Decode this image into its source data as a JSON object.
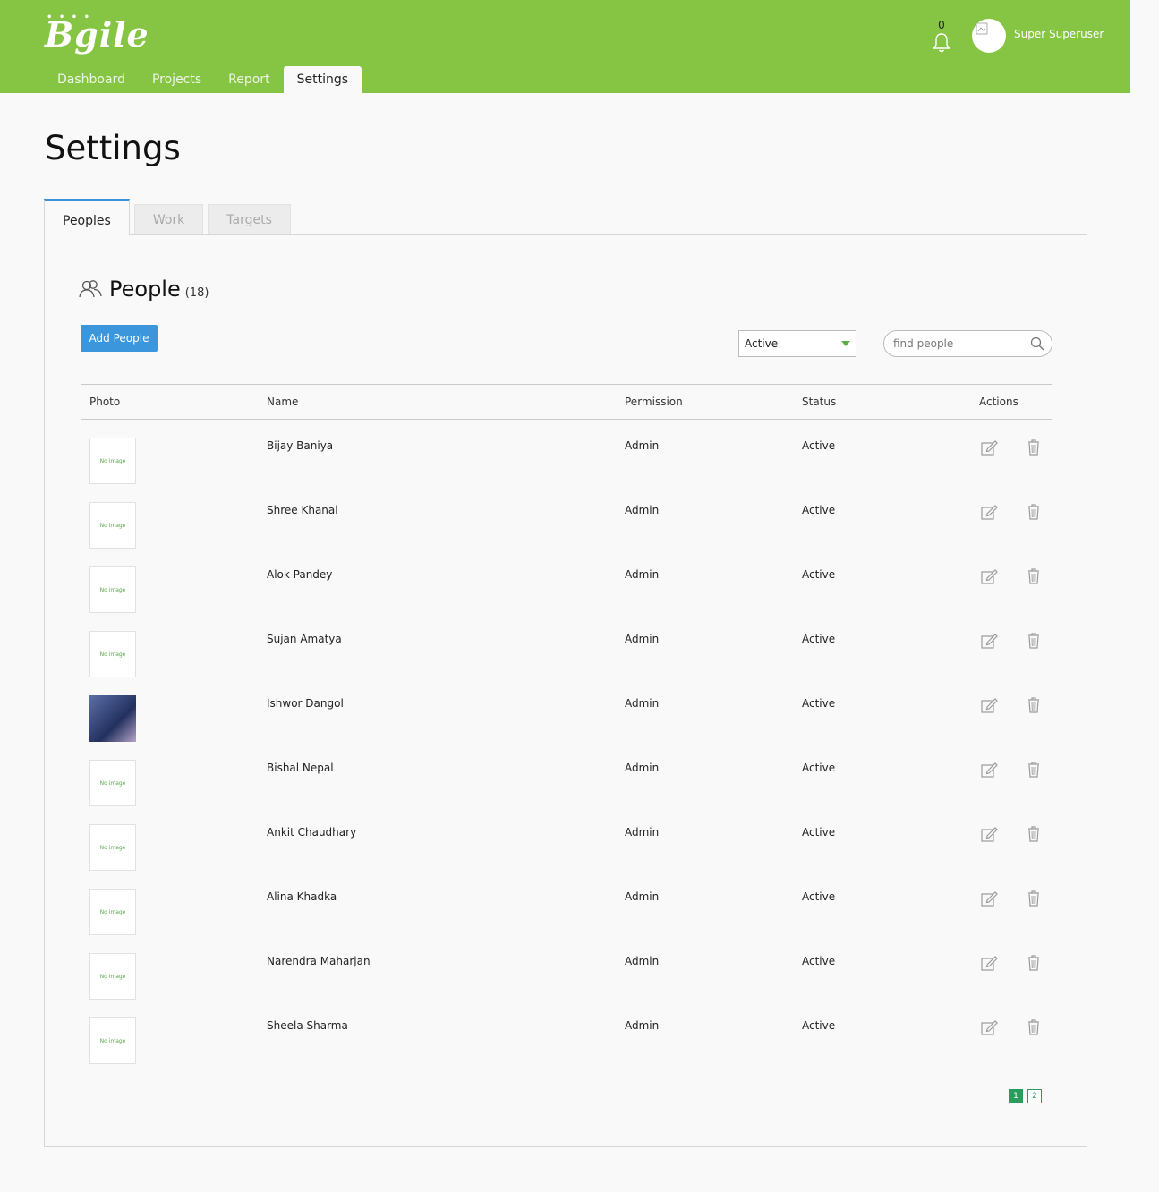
{
  "app": {
    "logo_text": "Bgile"
  },
  "nav": {
    "tabs": [
      "Dashboard",
      "Projects",
      "Report",
      "Settings"
    ],
    "active": "Settings"
  },
  "header": {
    "notification_count": "0",
    "user_name": "Super Superuser"
  },
  "page": {
    "title": "Settings"
  },
  "settings_tabs": [
    "Peoples",
    "Work",
    "Targets"
  ],
  "people": {
    "title": "People",
    "count": "(18)",
    "add_button": "Add People",
    "status_filter": "Active",
    "search_placeholder": "find people",
    "columns": [
      "Photo",
      "Name",
      "Permission",
      "Status",
      "Actions"
    ],
    "no_image_text": "No image",
    "rows": [
      {
        "name": "Bijay Baniya",
        "permission": "Admin",
        "status": "Active",
        "has_photo": false
      },
      {
        "name": "Shree Khanal",
        "permission": "Admin",
        "status": "Active",
        "has_photo": false
      },
      {
        "name": "Alok Pandey",
        "permission": "Admin",
        "status": "Active",
        "has_photo": false
      },
      {
        "name": "Sujan Amatya",
        "permission": "Admin",
        "status": "Active",
        "has_photo": false
      },
      {
        "name": "Ishwor Dangol",
        "permission": "Admin",
        "status": "Active",
        "has_photo": true
      },
      {
        "name": "Bishal Nepal",
        "permission": "Admin",
        "status": "Active",
        "has_photo": false
      },
      {
        "name": "Ankit Chaudhary",
        "permission": "Admin",
        "status": "Active",
        "has_photo": false
      },
      {
        "name": "Alina Khadka",
        "permission": "Admin",
        "status": "Active",
        "has_photo": false
      },
      {
        "name": "Narendra Maharjan",
        "permission": "Admin",
        "status": "Active",
        "has_photo": false
      },
      {
        "name": "Sheela Sharma",
        "permission": "Admin",
        "status": "Active",
        "has_photo": false
      }
    ],
    "pagination": {
      "pages": [
        "1",
        "2"
      ],
      "current": "1"
    }
  },
  "colors": {
    "header_green": "#86c443",
    "accent_blue": "#3c96dc",
    "pager_green": "#2a9d5d"
  },
  "icons": {
    "notification": "bell-icon",
    "people": "people-icon",
    "search": "search-icon",
    "edit": "edit-icon",
    "delete": "trash-icon"
  }
}
